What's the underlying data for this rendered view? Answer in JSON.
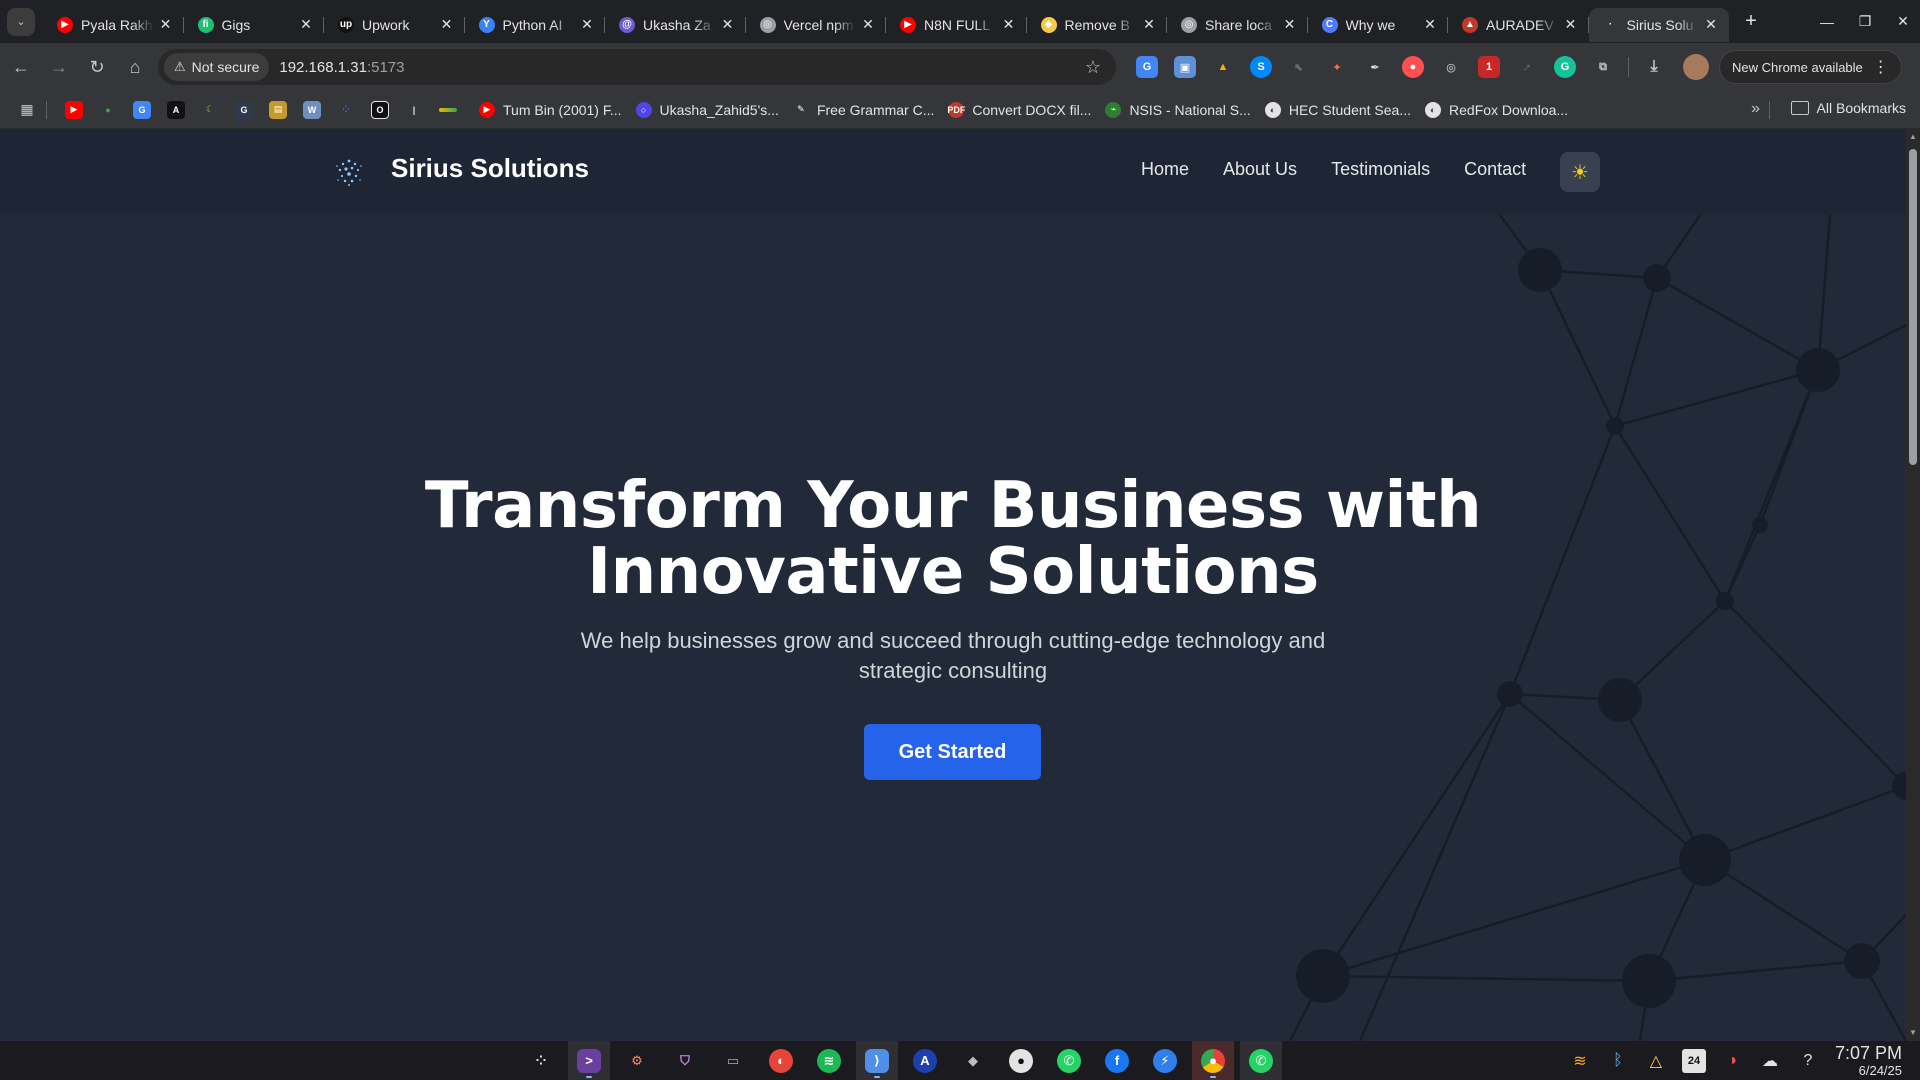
{
  "browser": {
    "tabs": [
      {
        "title": "Pyala Rakh",
        "favicon": "youtube-icon",
        "color": "#ff0000",
        "glyph": "▶"
      },
      {
        "title": "Gigs",
        "favicon": "fiverr-icon",
        "color": "#1dbf73",
        "glyph": "fi"
      },
      {
        "title": "Upwork",
        "favicon": "upwork-icon",
        "color": "#111111",
        "glyph": "up"
      },
      {
        "title": "Python AI",
        "favicon": "python-ai-icon",
        "color": "#3b82f6",
        "glyph": "Y"
      },
      {
        "title": "Ukasha Za",
        "favicon": "spiral-icon",
        "color": "#6d5bd0",
        "glyph": "@"
      },
      {
        "title": "Vercel npm",
        "favicon": "globe-icon",
        "color": "#9aa0a6",
        "glyph": "◎"
      },
      {
        "title": "N8N FULL",
        "favicon": "youtube-icon",
        "color": "#ff0000",
        "glyph": "▶"
      },
      {
        "title": "Remove B",
        "favicon": "remove-bg-icon",
        "color": "#f7c948",
        "glyph": "◆"
      },
      {
        "title": "Share loca",
        "favicon": "globe-icon",
        "color": "#9aa0a6",
        "glyph": "◎"
      },
      {
        "title": "Why we",
        "favicon": "c-icon",
        "color": "#4f7cff",
        "glyph": "C"
      },
      {
        "title": "AURADEV",
        "favicon": "triangle-icon",
        "color": "#c0392b",
        "glyph": "▲"
      },
      {
        "title": "Sirius Solu",
        "favicon": "sirius-icon",
        "color": "#35363a",
        "glyph": "·",
        "active": true
      }
    ],
    "new_tab": "+",
    "window_controls": {
      "minimize": "—",
      "restore": "❐",
      "close": "✕"
    },
    "security_label": "Not secure",
    "url_host": "192.168.1.31",
    "url_port": ":5173",
    "update_label": "New Chrome available",
    "bookmarks": [
      {
        "label": "Tum Bin (2001) F...",
        "color": "#ff0000",
        "glyph": "▶"
      },
      {
        "label": "Ukasha_Zahid5's...",
        "color": "#4f46e5",
        "glyph": "○"
      },
      {
        "label": "Free Grammar C...",
        "color": "#35363a",
        "glyph": "✎"
      },
      {
        "label": "Convert DOCX fil...",
        "color": "#c0392b",
        "glyph": "PDF"
      },
      {
        "label": "NSIS - National S...",
        "color": "#2e7d32",
        "glyph": "⌁"
      },
      {
        "label": "HEC Student Sea...",
        "color": "#e3e3e3",
        "glyph": "◐"
      },
      {
        "label": "RedFox Downloa...",
        "color": "#e3e3e3",
        "glyph": "◐"
      }
    ],
    "all_bookmarks_label": "All Bookmarks"
  },
  "site": {
    "brand": "Sirius Solutions",
    "nav": [
      "Home",
      "About Us",
      "Testimonials",
      "Contact"
    ],
    "theme_toggle_icon": "☀",
    "hero": {
      "title_line1": "Transform Your Business with",
      "title_line2": "Innovative Solutions",
      "subtitle": "We help businesses grow and succeed through cutting-edge technology and strategic consulting",
      "cta_label": "Get Started"
    },
    "colors": {
      "accent": "#2563eb",
      "background": "#222a39",
      "header": "#1e2635",
      "sun": "#facc15"
    }
  },
  "taskbar": {
    "time": "7:07 PM",
    "date": "6/24/25",
    "calendar_day": "24"
  }
}
